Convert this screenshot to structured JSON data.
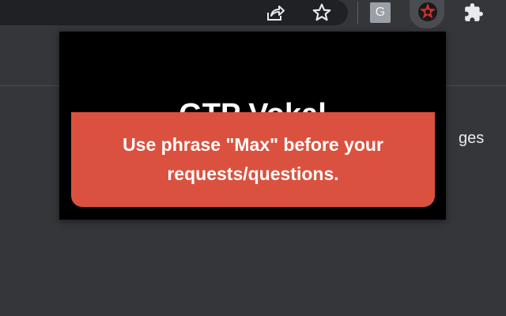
{
  "toolbar": {
    "icons": {
      "share": "share-icon",
      "bookmark": "star-icon",
      "grammarly": "g-extension-icon",
      "active_extension": "gtp-vokal-logo-icon",
      "extensions": "puzzle-icon"
    },
    "g_ext_label": "G"
  },
  "background_page": {
    "partial_text": "ges"
  },
  "popup": {
    "title": "GTP Vokal",
    "message": "Use phrase \"Max\" before your requests/questions."
  },
  "colors": {
    "chrome_toolbar": "#35363a",
    "omnibox": "#202124",
    "popup_background": "#000000",
    "banner_background": "#da523f",
    "text_white": "#ffffff",
    "logo_red": "#d32f2f"
  }
}
